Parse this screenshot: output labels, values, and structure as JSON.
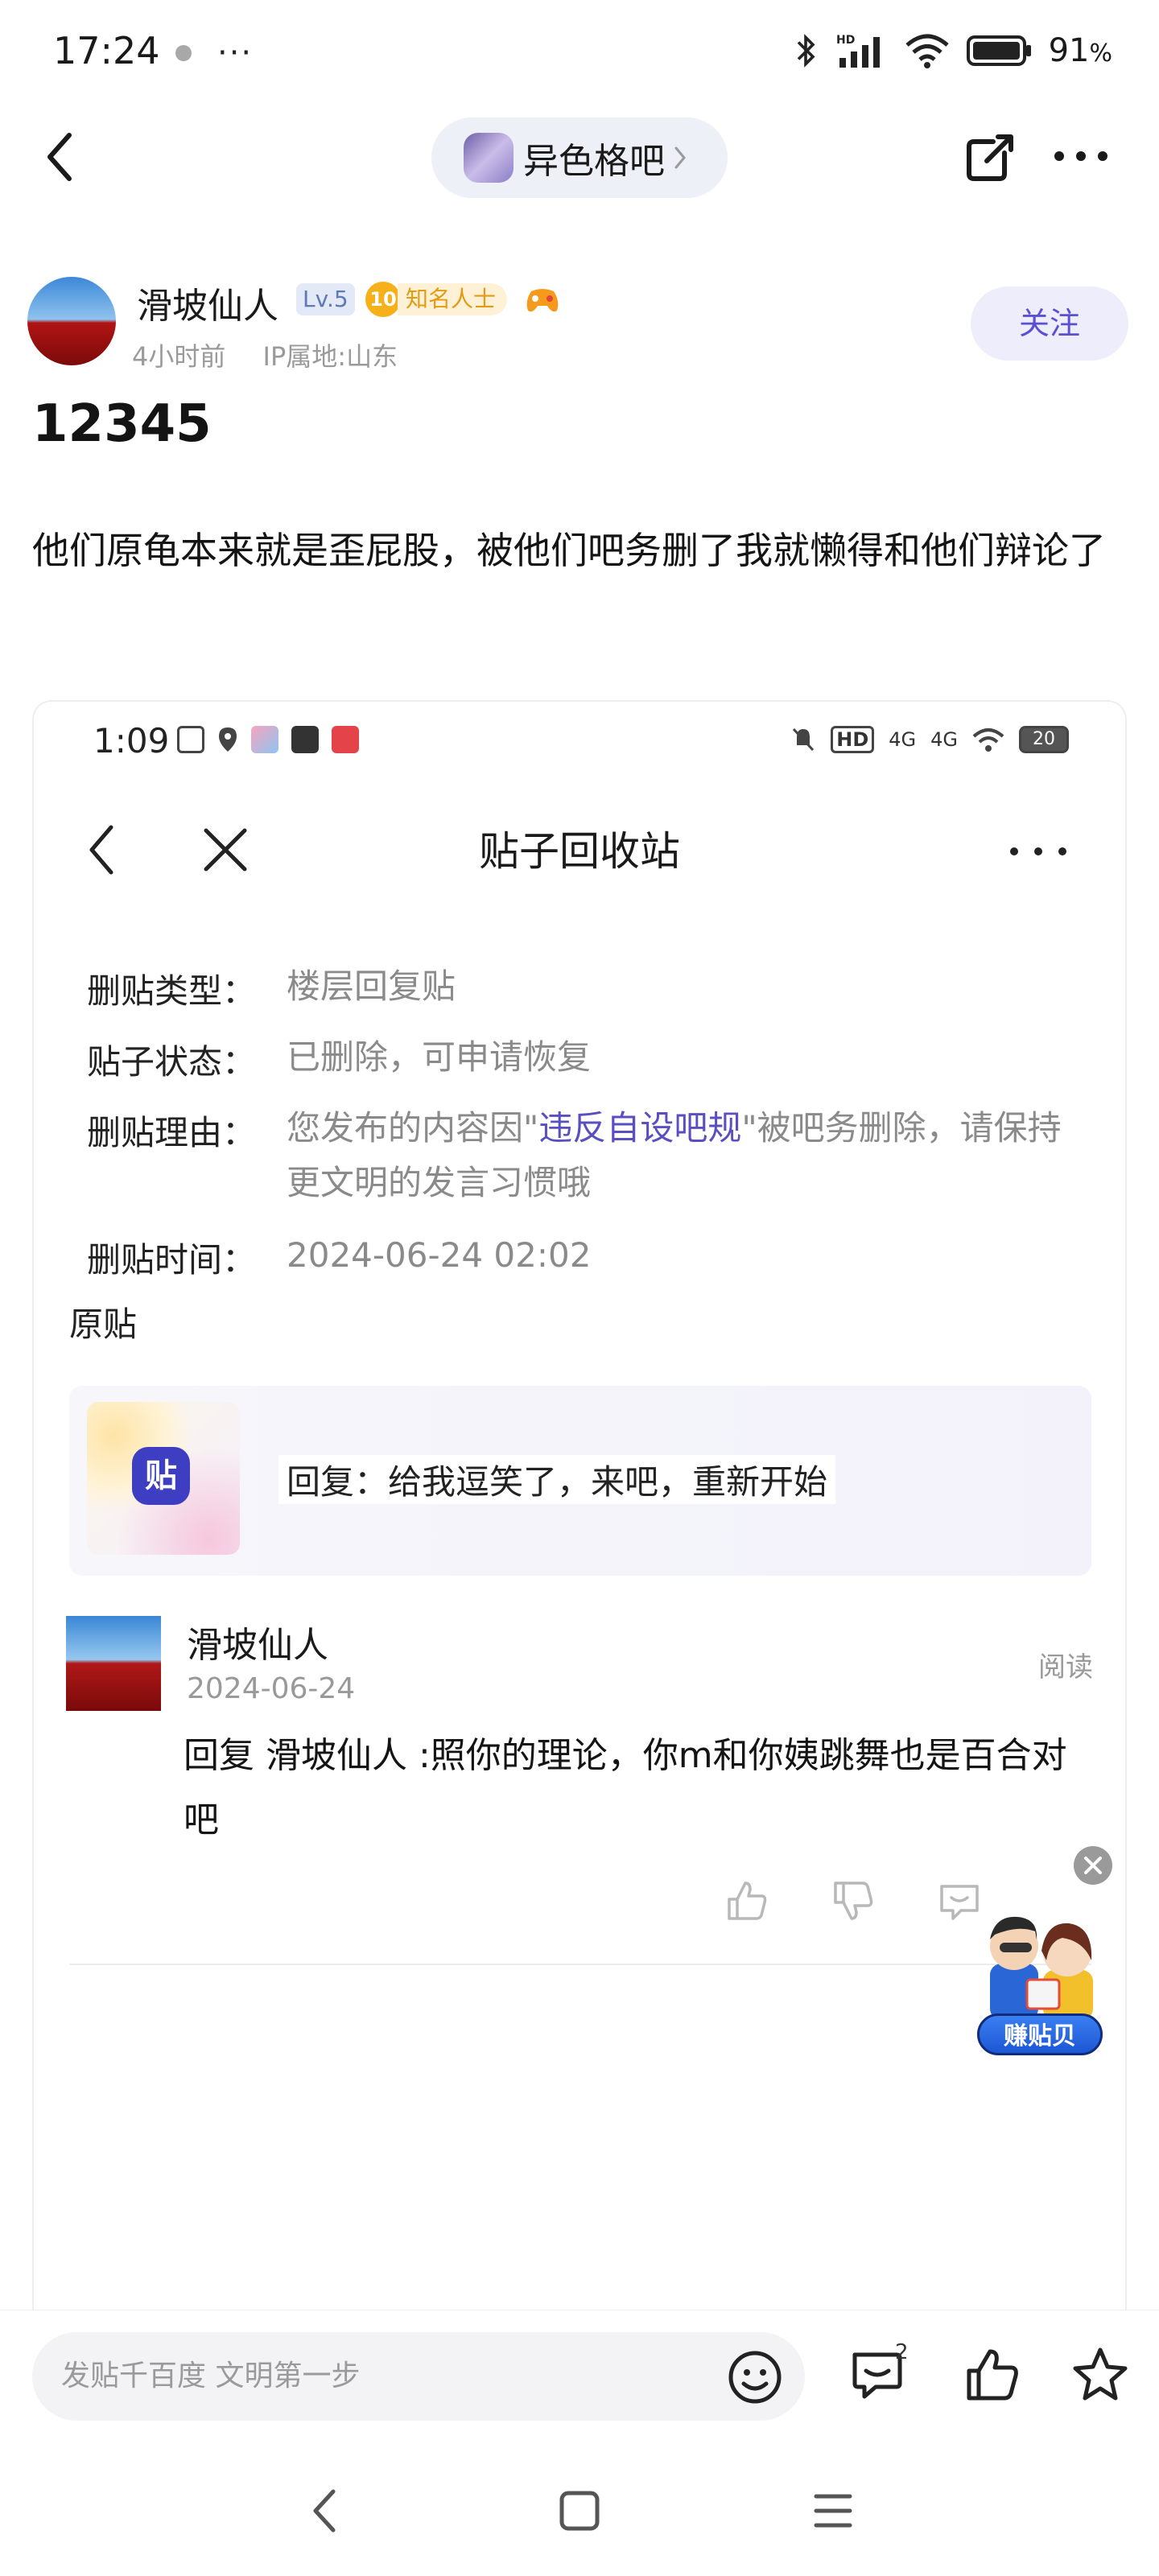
{
  "status_bar": {
    "time": "17:24",
    "more": "···",
    "battery_percent": "91",
    "battery_unit": "%",
    "icons": [
      "bluetooth-icon",
      "hd-signal-icon",
      "wifi-icon",
      "battery-icon"
    ]
  },
  "header": {
    "forum_name": "异色格吧",
    "icons": [
      "back-icon",
      "share-icon",
      "more-icon"
    ]
  },
  "author": {
    "name": "滑坡仙人",
    "level": "Lv.5",
    "badge_level": "10",
    "badge_title": "知名人士",
    "time_ago": "4小时前",
    "ip_location": "IP属地:山东",
    "follow_label": "关注"
  },
  "post": {
    "title": "12345",
    "body": "他们原龟本来就是歪屁股，被他们吧务删了我就懒得和他们辩论了"
  },
  "embedded": {
    "status_time": "1:09",
    "battery": "20",
    "network": [
      "4G",
      "4G"
    ],
    "page_title": "贴子回收站",
    "fields": [
      {
        "label": "删贴类型：",
        "value": "楼层回复贴"
      },
      {
        "label": "贴子状态：",
        "value": "已删除，可申请恢复"
      },
      {
        "label": "删贴理由：",
        "value_pre": "您发布的内容因\"",
        "value_link": "违反自设吧规",
        "value_post": "\"被吧务删除，请保持更文明的发言习惯哦"
      },
      {
        "label": "删贴时间：",
        "value": "2024-06-24 02:02"
      }
    ],
    "original_label": "原贴",
    "original_card_logo": "贴",
    "original_card_text": "回复：给我逗笑了，来吧，重新开始",
    "reply": {
      "username": "滑坡仙人",
      "date": "2024-06-24",
      "read_label": "阅读",
      "content": " 回复 滑坡仙人 :照你的理论，你m和你姨跳舞也是百合对吧"
    }
  },
  "promo": {
    "label": "赚贴贝"
  },
  "bottom_bar": {
    "input_placeholder": "发贴千百度 文明第一步",
    "reply_count": "2"
  },
  "colors": {
    "accent": "#5b4fd6",
    "follow_bg": "#eeedfb",
    "badge_gold": "#f6b01a",
    "link": "#5a4fc0"
  }
}
